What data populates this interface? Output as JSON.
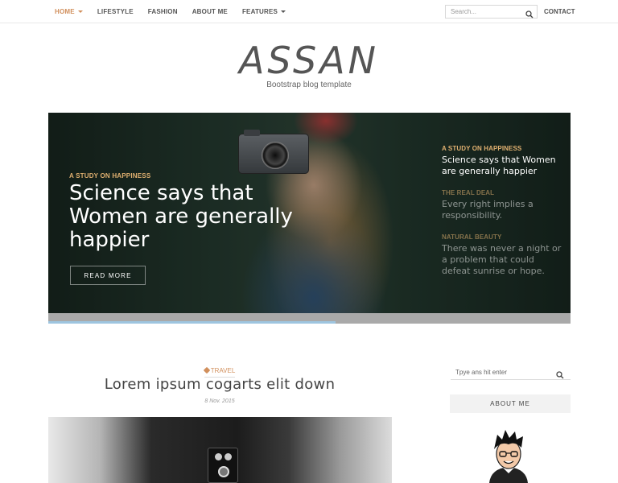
{
  "nav": {
    "items": [
      {
        "label": "HOME",
        "dropdown": true,
        "active": true
      },
      {
        "label": "LIFESTYLE",
        "dropdown": false,
        "active": false
      },
      {
        "label": "FASHION",
        "dropdown": false,
        "active": false
      },
      {
        "label": "ABOUT ME",
        "dropdown": false,
        "active": false
      },
      {
        "label": "FEATURES",
        "dropdown": true,
        "active": false
      }
    ],
    "search_placeholder": "Search...",
    "contact": "CONTACT"
  },
  "brand": {
    "logo": "ASSAN",
    "tagline": "Bootstrap blog template"
  },
  "hero": {
    "category": "A STUDY ON HAPPINESS",
    "title": "Science says that Women are generally happier",
    "button": "READ MORE",
    "side_items": [
      {
        "category": "A STUDY ON HAPPINESS",
        "title": "Science says that Women are generally happier"
      },
      {
        "category": "THE REAL DEAL",
        "title": "Every right implies a responsibility."
      },
      {
        "category": "NATURAL BEAUTY",
        "title": "There was never a night or a problem that could defeat sunrise or hope."
      }
    ],
    "progress": 0.55
  },
  "post": {
    "tag": "TRAVEL",
    "title": "Lorem ipsum cogarts elit down",
    "date": "8 Nov. 2015"
  },
  "sidebar": {
    "search_placeholder": "Tpye ans hit enter",
    "about_heading": "ABOUT ME"
  },
  "colors": {
    "accent": "#d18f5c",
    "hero_category": "#e0b070",
    "progress_fill": "#9ec5e0"
  }
}
